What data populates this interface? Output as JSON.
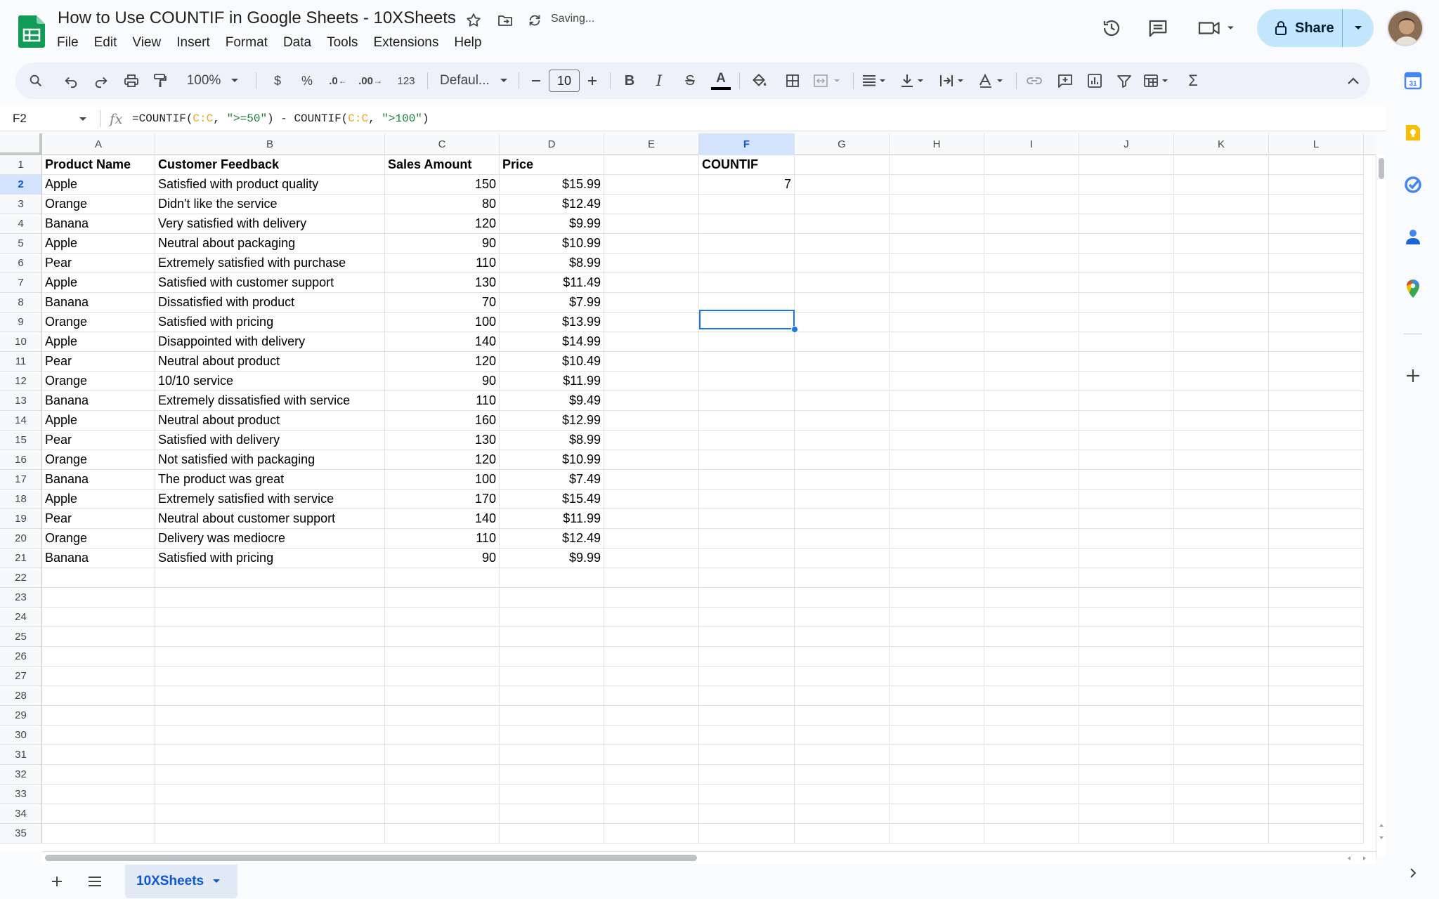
{
  "document": {
    "title": "How to Use COUNTIF in Google Sheets - 10XSheets",
    "saving_status": "Saving..."
  },
  "menu": [
    "File",
    "Edit",
    "View",
    "Insert",
    "Format",
    "Data",
    "Tools",
    "Extensions",
    "Help"
  ],
  "share": {
    "label": "Share"
  },
  "toolbar": {
    "zoom": "100%",
    "currency": "$",
    "percent": "%",
    "decrease_decimal": ".0",
    "increase_decimal": ".00",
    "number_format": "123",
    "font": "Defaul...",
    "font_size": "10",
    "bold": "B",
    "italic": "I",
    "strikethrough": "S",
    "text_color": "A",
    "functions": "Σ"
  },
  "formula_bar": {
    "cell_ref": "F2",
    "formula_parts": [
      "=COUNTIF(",
      "C:C",
      ", ",
      "\">=50\"",
      ") - COUNTIF(",
      "C:C",
      ", ",
      "\">100\"",
      ")"
    ]
  },
  "grid": {
    "columns": [
      "A",
      "B",
      "C",
      "D",
      "E",
      "F",
      "G",
      "H",
      "I",
      "J",
      "K",
      "L"
    ],
    "selected_column": "F",
    "selected_row": 2,
    "headers": {
      "A": "Product Name",
      "B": "Customer Feedback",
      "C": "Sales Amount",
      "D": "Price",
      "F": "COUNTIF"
    },
    "rows": [
      [
        "Apple",
        "Satisfied with product quality",
        "150",
        "$15.99"
      ],
      [
        "Orange",
        "Didn't like the service",
        "80",
        "$12.49"
      ],
      [
        "Banana",
        "Very satisfied with delivery",
        "120",
        "$9.99"
      ],
      [
        "Apple",
        "Neutral about packaging",
        "90",
        "$10.99"
      ],
      [
        "Pear",
        "Extremely satisfied with purchase",
        "110",
        "$8.99"
      ],
      [
        "Apple",
        "Satisfied with customer support",
        "130",
        "$11.49"
      ],
      [
        "Banana",
        "Dissatisfied with product",
        "70",
        "$7.99"
      ],
      [
        "Orange",
        "Satisfied with pricing",
        "100",
        "$13.99"
      ],
      [
        "Apple",
        "Disappointed with delivery",
        "140",
        "$14.99"
      ],
      [
        "Pear",
        "Neutral about product",
        "120",
        "$10.49"
      ],
      [
        "Orange",
        "10/10 service",
        "90",
        "$11.99"
      ],
      [
        "Banana",
        "Extremely dissatisfied with service",
        "110",
        "$9.49"
      ],
      [
        "Apple",
        "Neutral about product",
        "160",
        "$12.99"
      ],
      [
        "Pear",
        "Satisfied with delivery",
        "130",
        "$8.99"
      ],
      [
        "Orange",
        "Not satisfied with packaging",
        "120",
        "$10.99"
      ],
      [
        "Banana",
        "The product was great",
        "100",
        "$7.49"
      ],
      [
        "Apple",
        "Extremely satisfied with service",
        "170",
        "$15.49"
      ],
      [
        "Pear",
        "Neutral about customer support",
        "140",
        "$11.99"
      ],
      [
        "Orange",
        "Delivery was mediocre",
        "110",
        "$12.49"
      ],
      [
        "Banana",
        "Satisfied with pricing",
        "90",
        "$9.99"
      ]
    ],
    "countif_result": "7",
    "row_numbers": [
      "1",
      "2",
      "3",
      "4",
      "5",
      "6",
      "7",
      "8",
      "9",
      "10",
      "11",
      "12",
      "13",
      "14",
      "15",
      "16",
      "17",
      "18",
      "19",
      "20",
      "21",
      "22",
      "23",
      "24",
      "25",
      "26",
      "27",
      "28",
      "29",
      "30",
      "31",
      "32",
      "33",
      "34",
      "35"
    ]
  },
  "sheets": {
    "active_tab": "10XSheets"
  },
  "colors": {
    "accent": "#0b57d0",
    "share_bg": "#c2e7ff",
    "selection": "#1a73e8",
    "sheets_green": "#0f9d58",
    "formula_ref": "#f5a623",
    "formula_string": "#188038"
  },
  "side_panel_icons": [
    "calendar-icon",
    "keep-icon",
    "tasks-icon",
    "contacts-icon",
    "maps-icon",
    "add-icon"
  ]
}
